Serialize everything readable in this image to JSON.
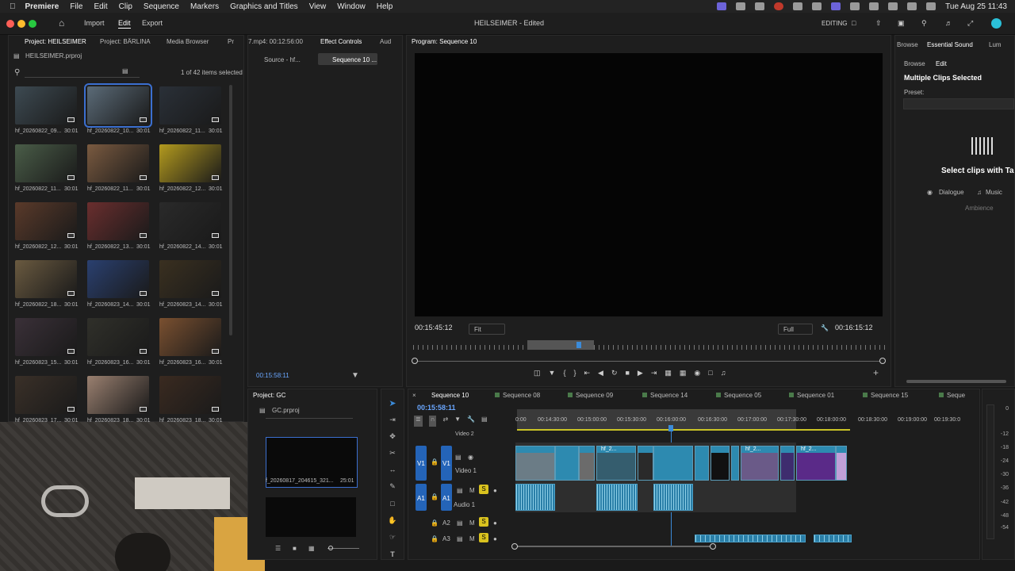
{
  "menubar": {
    "app": "Premiere",
    "items": [
      "File",
      "Edit",
      "Clip",
      "Sequence",
      "Markers",
      "Graphics and Titles",
      "View",
      "Window",
      "Help"
    ],
    "datetime": "Tue Aug 25  11:43"
  },
  "appbar": {
    "workspaces": [
      "Import",
      "Edit",
      "Export"
    ],
    "active": "Edit",
    "title": "HEILSEIMER - Edited",
    "mode": "EDITING"
  },
  "project": {
    "tabs": [
      "Project: HEILSEIMER",
      "Project: BÄRLINA",
      "Media Browser",
      "Pr"
    ],
    "file": "HEILSEIMER.prproj",
    "selection": "1 of 42 items selected",
    "clips": [
      {
        "name": "hf_20260822_09...",
        "dur": "30:01"
      },
      {
        "name": "hf_20260822_10...",
        "dur": "30:01"
      },
      {
        "name": "hf_20260822_11...",
        "dur": "30:01"
      },
      {
        "name": "hf_20260822_11...",
        "dur": "30:01"
      },
      {
        "name": "hf_20260822_11...",
        "dur": "30:01"
      },
      {
        "name": "hf_20260822_12...",
        "dur": "30:01"
      },
      {
        "name": "hf_20260822_12...",
        "dur": "30:01"
      },
      {
        "name": "hf_20260822_13...",
        "dur": "30:01"
      },
      {
        "name": "hf_20260822_14...",
        "dur": "30:01"
      },
      {
        "name": "hf_20260822_18...",
        "dur": "30:01"
      },
      {
        "name": "hf_20260823_14...",
        "dur": "30:01"
      },
      {
        "name": "hf_20260823_14...",
        "dur": "30:01"
      },
      {
        "name": "hf_20260823_15...",
        "dur": "30:01"
      },
      {
        "name": "hf_20260823_16...",
        "dur": "30:01"
      },
      {
        "name": "hf_20260823_16...",
        "dur": "30:01"
      },
      {
        "name": "hf_20260823_17...",
        "dur": "30:01"
      },
      {
        "name": "hf_20260823_18...",
        "dur": "30:01"
      },
      {
        "name": "hf_20260823_18...",
        "dur": "30:01"
      }
    ]
  },
  "effects": {
    "header_time": "7.mp4: 00:12:56:00",
    "tabs": [
      "Effect Controls",
      "Aud"
    ],
    "sub_tabs": [
      "Source - hf...",
      "Sequence 10 ..."
    ],
    "timecode": "00:15:58:11"
  },
  "program": {
    "title": "Program: Sequence 10",
    "tc_left": "00:15:45:12",
    "fit": "Fit",
    "quality": "Full",
    "tc_right": "00:16:15:12"
  },
  "essential": {
    "tabs": [
      "Browse",
      "Edit"
    ],
    "title_tab": "Essential Sound",
    "lumetri": "Lum",
    "heading": "Multiple Clips Selected",
    "preset": "Preset:",
    "select_text": "Select clips with Ta",
    "types": [
      "Dialogue",
      "Music",
      "Ambience"
    ]
  },
  "project_gc": {
    "title": "Project: GC",
    "file": "GC.prproj",
    "clip_name": "f_20260817_204615_321...",
    "clip_dur": "25:01"
  },
  "timeline": {
    "tabs": [
      "Sequence 10",
      "Sequence 08",
      "Sequence 09",
      "Sequence 14",
      "Sequence 05",
      "Sequence 01",
      "Sequence 15",
      "Seque"
    ],
    "timecode": "00:15:58:11",
    "ruler": [
      "0:00",
      "00:14:30:00",
      "00:15:00:00",
      "00:15:30:00",
      "00:16:00:00",
      "00:16:30:00",
      "00:17:00:00",
      "00:17:30:00",
      "00:18:00:00",
      "00:18:30:00",
      "00:19:00:00",
      "00:19:30:0"
    ],
    "tracks": {
      "v2": "Video 2",
      "v1_src": "V1",
      "v1": "V1",
      "v1_name": "Video 1",
      "a1_src": "A1",
      "a1": "A1",
      "a1_name": "Audio 1",
      "a2": "A2",
      "a3": "A3",
      "m": "M",
      "s": "S"
    },
    "clip_labels": [
      "hf_2...",
      "hf_2...",
      "hf_2..."
    ],
    "meter": [
      "0",
      "-12",
      "-18",
      "-24",
      "-30",
      "-36",
      "-42",
      "-48",
      "-54"
    ]
  }
}
